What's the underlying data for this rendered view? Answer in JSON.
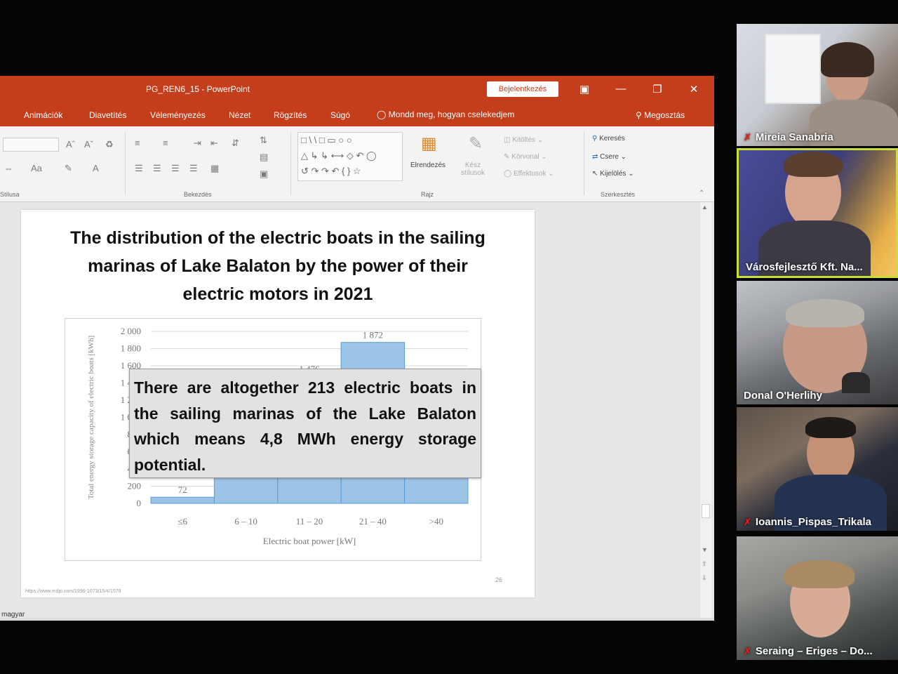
{
  "powerpoint": {
    "window_title": "PG_REN6_15  -  PowerPoint",
    "signin_label": "Bejelentkezés",
    "menu": {
      "items": [
        "Animációk",
        "Diavetítés",
        "Véleményezés",
        "Nézet",
        "Rögzítés",
        "Súgó"
      ],
      "tell_me": "Mondd meg, hogyan cselekedjem",
      "share": "Megosztás"
    },
    "ribbon": {
      "groups": [
        "Stílusa",
        "Bekezdés",
        "Rajz",
        "Szerkesztés"
      ],
      "arrange_label": "Elrendezés",
      "quick_styles_label": "Kész stílusok",
      "shape_fill": "Kitöltés",
      "shape_outline": "Körvonal",
      "shape_effects": "Effektusok",
      "find": "Keresés",
      "replace": "Csere",
      "select": "Kijelölés"
    },
    "status_lang": "magyar"
  },
  "slide": {
    "title_lines": [
      "The distribution of the electric boats in the sailing",
      "marinas of Lake Balaton by the power of their",
      "electric motors in 2021"
    ],
    "callout": "There are altogether 213 electric boats in the sailing marinas of the Lake Balaton which means 4,8 MWh energy storage potential.",
    "url": "https://www.mdpi.com/1996-1073/15/4/1578",
    "number": "26"
  },
  "chart_data": {
    "type": "bar",
    "categories": [
      "≤6",
      "6 – 10",
      "11 – 20",
      "21 – 40",
      ">40"
    ],
    "values": [
      72,
      1050,
      1476,
      1872,
      1050
    ],
    "data_labels": [
      "72",
      "",
      "1 476",
      "1 872",
      ""
    ],
    "ylabel": "Total energy storage capacity of electric boats [kWh]",
    "xlabel": "Electric boat power [kW]",
    "ylim": [
      0,
      2000
    ],
    "yticks": [
      0,
      200,
      400,
      600,
      800,
      1000,
      1200,
      1400,
      1600,
      1800,
      2000
    ],
    "ytick_labels": [
      "0",
      "200",
      "400",
      "600",
      "800",
      "1 000",
      "1 200",
      "1 400",
      "1 600",
      "1 800",
      "2 000"
    ],
    "bar_color": "#9dc3e6",
    "bar_border": "#5b9bd5",
    "grid": true
  },
  "participants": [
    {
      "name": "Mireia Sanabria",
      "muted": true
    },
    {
      "name": "Városfejlesztő Kft. Na...",
      "muted": false,
      "active_speaker": true
    },
    {
      "name": "Donal O'Herlihy",
      "muted": false
    },
    {
      "name": "Ioannis_Pispas_Trikala",
      "muted": true
    },
    {
      "name": "Seraing – Eriges – Do...",
      "muted": true
    }
  ],
  "colors": {
    "ppt_brand": "#c43e1c",
    "active_speaker": "#c9dd3b",
    "mic_muted": "#e02020"
  }
}
